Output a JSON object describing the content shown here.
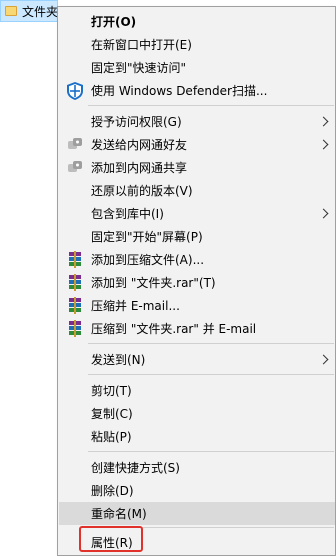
{
  "desktop": {
    "selected_item_label": "文件夹"
  },
  "menu": {
    "open": "打开(O)",
    "open_new_window": "在新窗口中打开(E)",
    "pin_quick_access": "固定到\"快速访问\"",
    "defender_scan": "使用 Windows Defender扫描...",
    "grant_access": "授予访问权限(G)",
    "send_to_lan_friend": "发送给内网通好友",
    "add_lan_share": "添加到内网通共享",
    "restore_versions": "还原以前的版本(V)",
    "include_in_library": "包含到库中(I)",
    "pin_start": "固定到\"开始\"屏幕(P)",
    "add_archive": "添加到压缩文件(A)...",
    "add_to_rar": "添加到 \"文件夹.rar\"(T)",
    "compress_email": "压缩并 E-mail...",
    "compress_rar_email": "压缩到 \"文件夹.rar\" 并 E-mail",
    "send_to": "发送到(N)",
    "cut": "剪切(T)",
    "copy": "复制(C)",
    "paste": "粘贴(P)",
    "create_shortcut": "创建快捷方式(S)",
    "delete": "删除(D)",
    "rename": "重命名(M)",
    "properties": "属性(R)"
  },
  "colors": {
    "menu_bg": "#f2f2f2",
    "hover_bg": "#dadada",
    "highlight_border": "#e0322b"
  }
}
